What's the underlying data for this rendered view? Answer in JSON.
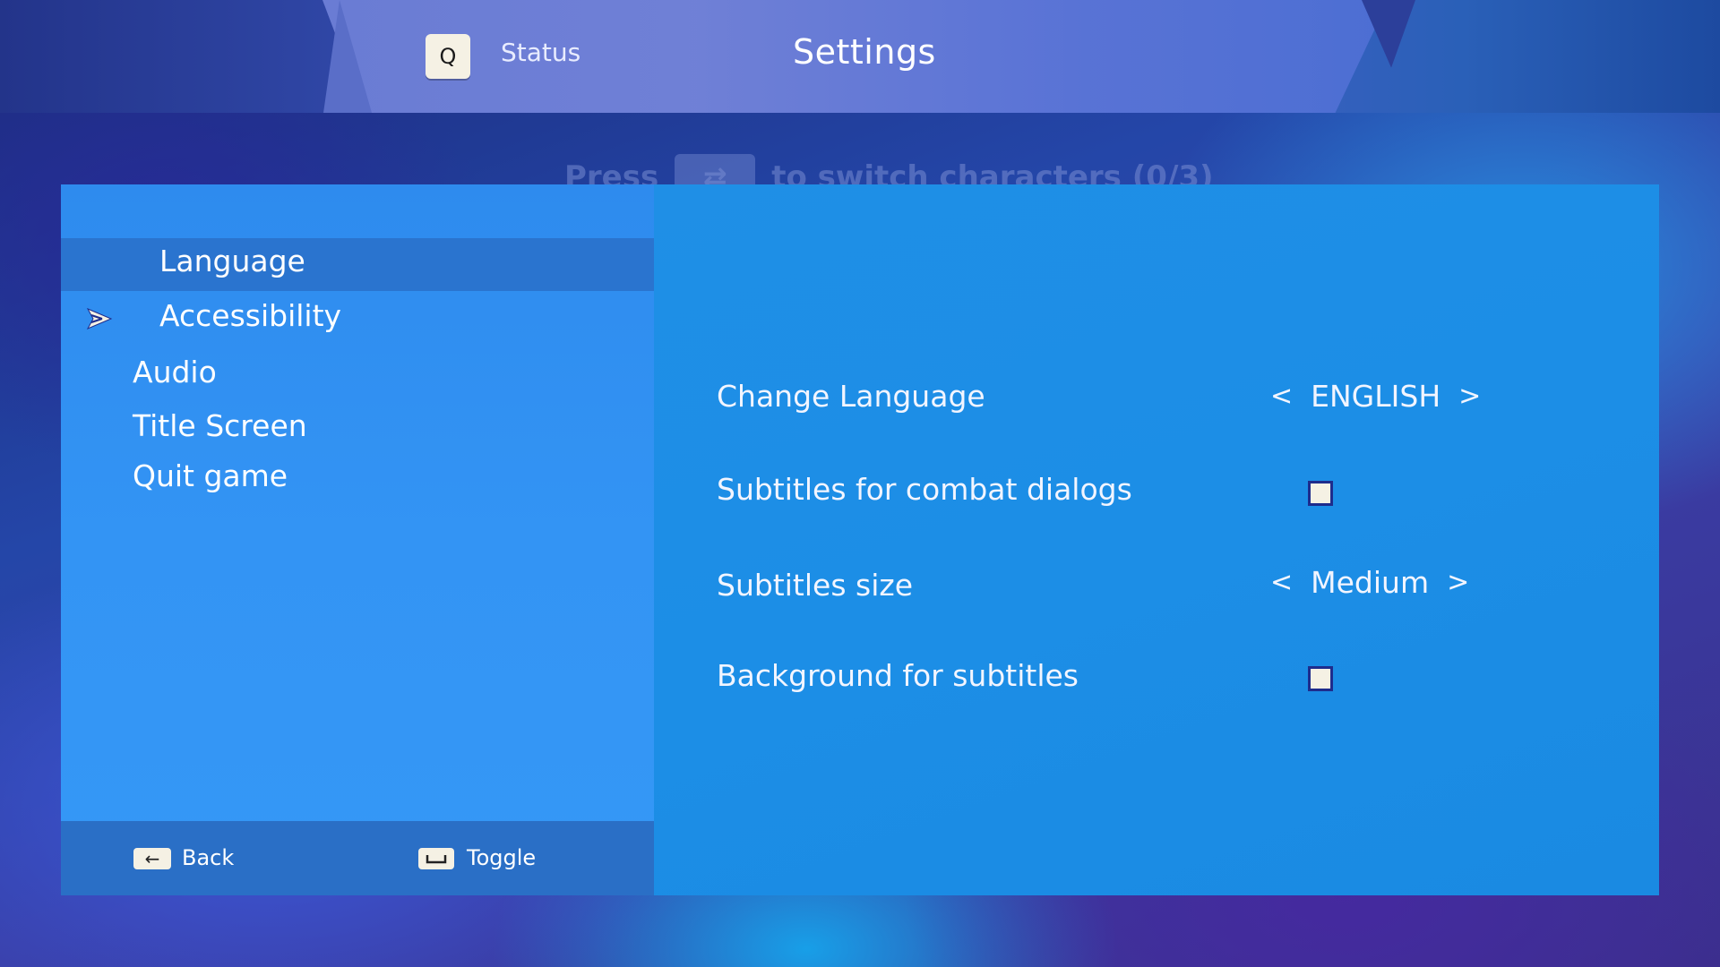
{
  "header": {
    "status_key": "Q",
    "status_label": "Status",
    "title": "Settings",
    "hint_prefix": "Press",
    "hint_suffix": "to switch characters (0/3)"
  },
  "menu": {
    "items": [
      {
        "label": "Language",
        "state": "highlighted"
      },
      {
        "label": "Accessibility",
        "state": "cursor"
      },
      {
        "label": "Audio"
      },
      {
        "label": "Title Screen"
      },
      {
        "label": "Quit game"
      }
    ]
  },
  "footer": {
    "back_label": "Back",
    "toggle_label": "Toggle"
  },
  "options": [
    {
      "label": "Change Language",
      "type": "selector",
      "value": "ENGLISH"
    },
    {
      "label": "Subtitles for combat dialogs",
      "type": "checkbox",
      "checked": false
    },
    {
      "label": "Subtitles size",
      "type": "selector",
      "value": "Medium"
    },
    {
      "label": "Background for subtitles",
      "type": "checkbox",
      "checked": false
    }
  ],
  "glyphs": {
    "left_arrow": "<",
    "right_arrow": ">",
    "swap_icon": "⇄",
    "back_icon": "←"
  },
  "colors": {
    "panel_left": "#3394f4",
    "panel_right": "#1c8ee6",
    "highlight": "#2a74cf",
    "keycap": "#f5f1e4"
  }
}
